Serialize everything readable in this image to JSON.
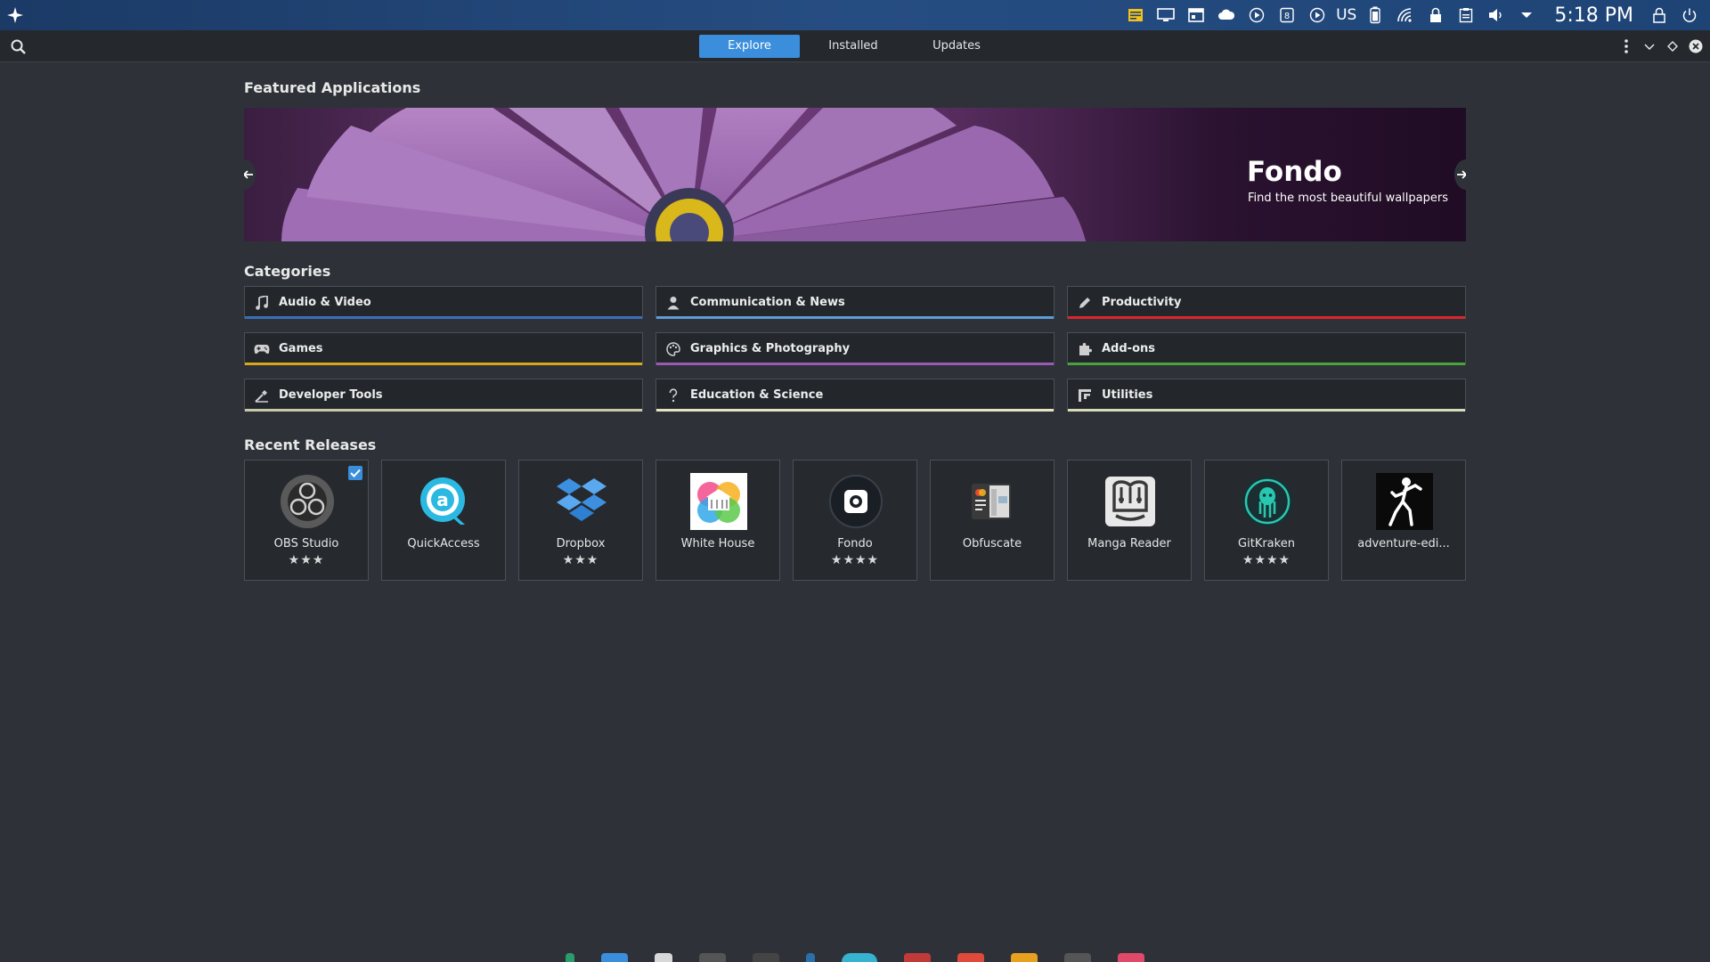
{
  "panel": {
    "language": "US",
    "clock": "5:18 PM"
  },
  "header": {
    "tabs": [
      {
        "label": "Explore",
        "active": true
      },
      {
        "label": "Installed",
        "active": false
      },
      {
        "label": "Updates",
        "active": false
      }
    ]
  },
  "featured": {
    "section_title": "Featured Applications",
    "app_name": "Fondo",
    "tagline": "Find the most beautiful wallpapers"
  },
  "categories": {
    "section_title": "Categories",
    "items": [
      {
        "label": "Audio & Video",
        "icon": "music-note-icon",
        "color": "#3a6fb8"
      },
      {
        "label": "Communication & News",
        "icon": "person-icon",
        "color": "#5f9bd6"
      },
      {
        "label": "Productivity",
        "icon": "pencil-icon",
        "color": "#d9262b"
      },
      {
        "label": "Games",
        "icon": "gamepad-icon",
        "color": "#d7a81a"
      },
      {
        "label": "Graphics & Photography",
        "icon": "palette-icon",
        "color": "#9a59b5"
      },
      {
        "label": "Add-ons",
        "icon": "puzzle-icon",
        "color": "#4aa23a"
      },
      {
        "label": "Developer Tools",
        "icon": "build-icon",
        "color": "#c9c9a8"
      },
      {
        "label": "Education & Science",
        "icon": "question-icon",
        "color": "#e4e4c0"
      },
      {
        "label": "Utilities",
        "icon": "utilities-icon",
        "color": "#d7dcb6"
      }
    ]
  },
  "recent": {
    "section_title": "Recent Releases",
    "apps": [
      {
        "name": "OBS Studio",
        "stars": "★★★",
        "icon": "obs-studio-icon",
        "installed": true
      },
      {
        "name": "QuickAccess",
        "stars": "",
        "icon": "quickaccess-icon",
        "installed": false
      },
      {
        "name": "Dropbox",
        "stars": "★★★",
        "icon": "dropbox-icon",
        "installed": false
      },
      {
        "name": "White House",
        "stars": "",
        "icon": "white-house-icon",
        "installed": false
      },
      {
        "name": "Fondo",
        "stars": "★★★★",
        "icon": "fondo-icon",
        "installed": false
      },
      {
        "name": "Obfuscate",
        "stars": "",
        "icon": "obfuscate-icon",
        "installed": false
      },
      {
        "name": "Manga Reader",
        "stars": "",
        "icon": "manga-reader-icon",
        "installed": false
      },
      {
        "name": "GitKraken",
        "stars": "★★★★",
        "icon": "gitkraken-icon",
        "installed": false
      },
      {
        "name": "adventure-edi...",
        "stars": "",
        "icon": "adventure-editor-icon",
        "installed": false
      }
    ]
  },
  "colors": {
    "accent": "#3b8edb",
    "background": "#2e3238",
    "panel": "#1e4476"
  }
}
